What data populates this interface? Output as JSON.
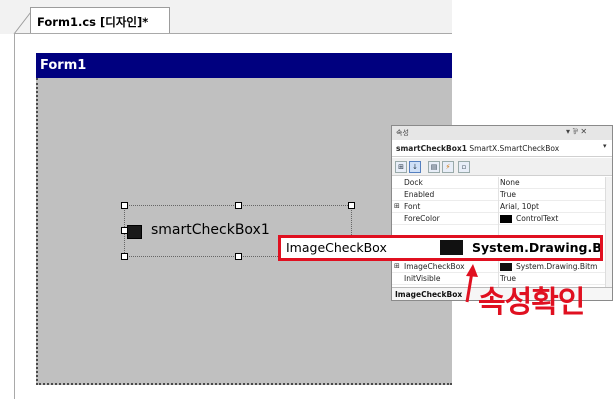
{
  "designer": {
    "tab_label": "Form1.cs [디자인]*"
  },
  "form": {
    "title": "Form1"
  },
  "control": {
    "label": "smartCheckBox1"
  },
  "properties": {
    "window_title": "속성",
    "pin_glyphs": "▾ ⅌ ✕",
    "object_name": "smartCheckBox1",
    "object_type": "SmartX.SmartCheckBox",
    "rows": [
      {
        "name": "Dock",
        "value": "None"
      },
      {
        "name": "Enabled",
        "value": "True"
      },
      {
        "name": "Font",
        "value": "Arial, 10pt",
        "expandable": true
      },
      {
        "name": "ForeColor",
        "value": "ControlText",
        "swatch": "#000000"
      },
      {
        "name": "ImageCheckBox",
        "value": "System.Drawing.Bitm",
        "swatch": "#111111",
        "expandable": true
      },
      {
        "name": "InitVisible",
        "value": "True"
      }
    ],
    "description_title": "ImageCheckBox"
  },
  "highlight": {
    "property_name": "ImageCheckBox",
    "property_value": "System.Drawing.Bitm",
    "swatch_color": "#111111",
    "border_color": "#e01020"
  },
  "annotation": {
    "text": "속성확인",
    "color": "#e01020"
  },
  "colors": {
    "form_titlebar": "#00007f",
    "form_body": "#c0c0c0"
  }
}
